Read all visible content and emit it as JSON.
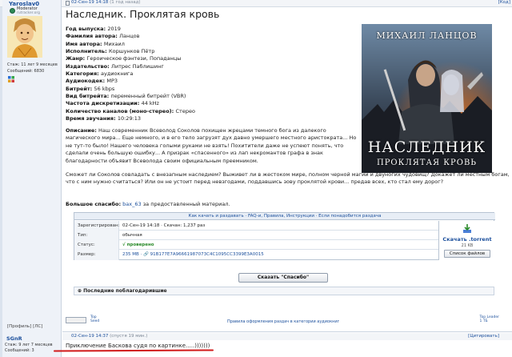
{
  "post": {
    "author": "Yaroslav0",
    "rank": "Moderator",
    "rank_sub": "rutracker.org",
    "stats": [
      "Стаж: 11 лет 9 месяцев",
      "Сообщений: 6830"
    ],
    "date": "02-Сен-19 14:18",
    "date_note": "(1 год назад)",
    "quote": "[Код]",
    "title": "Наследник. Проклятая кровь",
    "meta": [
      {
        "k": "Год выпуска",
        "v": "2019"
      },
      {
        "k": "Фамилия автора",
        "v": "Ланцов"
      },
      {
        "k": "Имя автора",
        "v": "Михаил"
      },
      {
        "k": "Исполнитель",
        "v": "Коршунков Пётр"
      },
      {
        "k": "Жанр",
        "v": "Героическое фэнтези, Попаданцы"
      },
      {
        "k": "Издательство",
        "v": "Литрес Паблишинг"
      },
      {
        "k": "Категория",
        "v": "аудиокнига"
      },
      {
        "k": "Аудиокодек",
        "v": "MP3"
      },
      {
        "k": "Битрейт",
        "v": "56 kbps"
      },
      {
        "k": "Вид битрейта",
        "v": "переменный битрейт (VBR)"
      },
      {
        "k": "Частота дискретизации",
        "v": "44 kHz"
      },
      {
        "k": "Количество каналов (моно-стерео)",
        "v": "Стерео"
      },
      {
        "k": "Время звучания",
        "v": "10:29:13"
      }
    ],
    "description_label": "Описание:",
    "description": "Наш современник Всеволод Соколов похищен жрецами темного бога из далекого магического мира... Еще немного, и в его тело загрузят дух давно умершего местного аристократа... Но не тут-то было! Нашего человека голыми руками не взять! Похитители даже не успеют понять, что сделали очень большую ошибку... А призрак «спасенного» из лап некромантов графа в знак благодарности объявит Всеволода своим официальным преемником.",
    "question": "Сможет ли Соколов совладать с внезапным наследием? Выживет ли в жестоком мире, полном черной магии и двуногих чудовищ? Докажет ли местным богам, что с ним нужно считаться? Или он не устоит перед невзгодами, поддавшись зову проклятой крови... предав всех, кто стал ему дорог?",
    "thanks_label": "Большое спасибо:",
    "thanks_user": "bax_63",
    "thanks_rest": "за предоставленный материал."
  },
  "cover": {
    "author": "МИХАИЛ ЛАНЦОВ",
    "title": "НАСЛЕДНИК",
    "subtitle": "ПРОКЛЯТАЯ КРОВЬ"
  },
  "torrent": {
    "links": "Как качать и раздавать · FAQ-и, Правила, Инструкции · Если понадобится раздача",
    "rows": [
      {
        "label": "Зарегистрирован:",
        "value": "02-Сен-19 14:18 · Скачан: 1,237 раз"
      },
      {
        "label": "Тип:",
        "value": "обычная"
      },
      {
        "label": "Статус:",
        "value": "√ проверено"
      },
      {
        "label": "Размер:",
        "value": "235 MB · 🔗 91B177E7A96661987073C4C1095CC3399E3A0015"
      }
    ],
    "download": "Скачать .torrent",
    "size": "21 KB",
    "file_list": "Список файлов",
    "thanks_button": "Сказать \"Спасибо\"",
    "last_thanks": "⊕ Последние поблагодарившие"
  },
  "share": {
    "top_seed": [
      "Top",
      "Seed"
    ],
    "report": "Правила оформления раздач в категории аудиокниг",
    "top_leader": [
      "Top Leader",
      "1 ТБ"
    ]
  },
  "sidebar": {
    "profile": "[Профиль]  [ЛС]"
  },
  "post2": {
    "author": "SGnR",
    "stats": [
      "Стаж: 9 лет 7 месяцев",
      "Сообщений: 3"
    ],
    "date": "02-Сен-19 14:37",
    "date_note": "(спустя 19 мин.)",
    "quote": "[Цитировать]",
    "text": "Приключение Баскова судя по картинке.....)))))))"
  },
  "colors": {
    "link": "#1b4f9c",
    "highlight_underline": "#d11a1a",
    "sidebar_bg": "#eef2f8"
  }
}
